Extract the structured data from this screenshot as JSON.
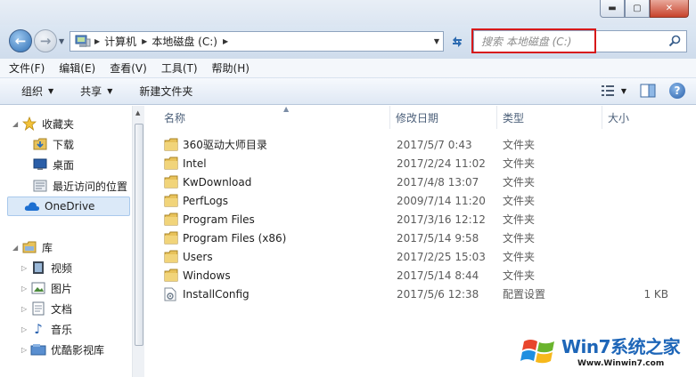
{
  "window": {
    "controls": {
      "minimize": "▬",
      "maximize": "▢",
      "close": "✕"
    }
  },
  "address": {
    "crumbs": [
      "计算机",
      "本地磁盘 (C:)"
    ],
    "search_placeholder": "搜索 本地磁盘 (C:)",
    "highlight_color": "#d7191a"
  },
  "menu": [
    "文件(F)",
    "编辑(E)",
    "查看(V)",
    "工具(T)",
    "帮助(H)"
  ],
  "toolbar": {
    "organize": "组织",
    "share": "共享",
    "new_folder": "新建文件夹"
  },
  "nav": {
    "favorites": {
      "label": "收藏夹",
      "items": [
        "下载",
        "桌面",
        "最近访问的位置"
      ]
    },
    "onedrive": "OneDrive",
    "libraries": {
      "label": "库",
      "items": [
        "视频",
        "图片",
        "文档",
        "音乐",
        "优酷影视库"
      ]
    }
  },
  "columns": {
    "name": "名称",
    "date": "修改日期",
    "type": "类型",
    "size": "大小"
  },
  "files": [
    {
      "name": "360驱动大师目录",
      "date": "2017/5/7 0:43",
      "type": "文件夹",
      "size": "",
      "kind": "folder"
    },
    {
      "name": "Intel",
      "date": "2017/2/24 11:02",
      "type": "文件夹",
      "size": "",
      "kind": "folder"
    },
    {
      "name": "KwDownload",
      "date": "2017/4/8 13:07",
      "type": "文件夹",
      "size": "",
      "kind": "folder"
    },
    {
      "name": "PerfLogs",
      "date": "2009/7/14 11:20",
      "type": "文件夹",
      "size": "",
      "kind": "folder"
    },
    {
      "name": "Program Files",
      "date": "2017/3/16 12:12",
      "type": "文件夹",
      "size": "",
      "kind": "folder"
    },
    {
      "name": "Program Files (x86)",
      "date": "2017/5/14 9:58",
      "type": "文件夹",
      "size": "",
      "kind": "folder"
    },
    {
      "name": "Users",
      "date": "2017/2/25 15:03",
      "type": "文件夹",
      "size": "",
      "kind": "folder"
    },
    {
      "name": "Windows",
      "date": "2017/5/14 8:44",
      "type": "文件夹",
      "size": "",
      "kind": "folder"
    },
    {
      "name": "InstallConfig",
      "date": "2017/5/6 12:38",
      "type": "配置设置",
      "size": "1 KB",
      "kind": "config"
    }
  ],
  "watermark": {
    "brand": "Win7系统之家",
    "url": "Www.Winwin7.com"
  }
}
